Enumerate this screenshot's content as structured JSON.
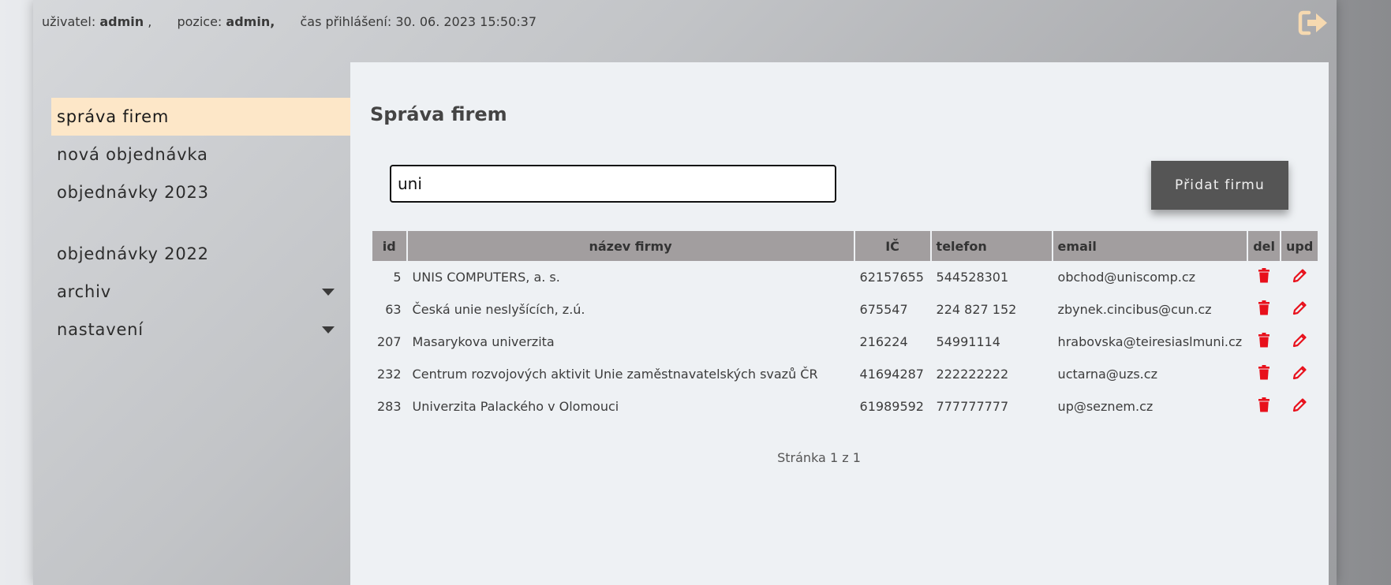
{
  "header": {
    "user_label": "uživatel:",
    "user_value": "admin",
    "user_sep": ",",
    "position_label": "pozice:",
    "position_value": "admin,",
    "login_time_label": "čas přihlášení:",
    "login_time_value": "30. 06. 2023 15:50:37",
    "logout_icon": "logout-icon",
    "accent": "#f6d9b0"
  },
  "sidebar": {
    "items": [
      {
        "label": "správa firem"
      },
      {
        "label": "nová objednávka"
      },
      {
        "label": "objednávky 2023"
      },
      {
        "label": "objednávky 2022"
      },
      {
        "label": "archiv"
      },
      {
        "label": "nastavení"
      }
    ],
    "active_color": "#fde7c8"
  },
  "main": {
    "title": "Správa firem",
    "search_value": "uni",
    "add_button": "Přidat firmu",
    "columns": [
      "id",
      "název firmy",
      "IČ",
      "telefon",
      "email",
      "del",
      "upd"
    ],
    "rows": [
      {
        "id": "5",
        "name": "UNIS COMPUTERS, a. s.",
        "ic": "62157655",
        "phone": "544528301",
        "email": "obchod@uniscomp.cz"
      },
      {
        "id": "63",
        "name": "Česká unie neslyšících, z.ú.",
        "ic": "675547",
        "phone": "224 827 152",
        "email": "zbynek.cincibus@cun.cz"
      },
      {
        "id": "207",
        "name": "Masarykova univerzita",
        "ic": "216224",
        "phone": "54991114",
        "email": "hrabovska@teiresiaslmuni.cz"
      },
      {
        "id": "232",
        "name": "Centrum rozvojových aktivit Unie zaměstnavatelských svazů ČR",
        "ic": "41694287",
        "phone": "222222222",
        "email": "uctarna@uzs.cz"
      },
      {
        "id": "283",
        "name": "Univerzita Palackého v Olomouci",
        "ic": "61989592",
        "phone": "777777777",
        "email": "up@seznem.cz"
      }
    ],
    "delete_icon": "trash-icon",
    "edit_icon": "pencil-icon",
    "icon_color": "#e8101b",
    "pager": "Stránka 1 z 1"
  }
}
